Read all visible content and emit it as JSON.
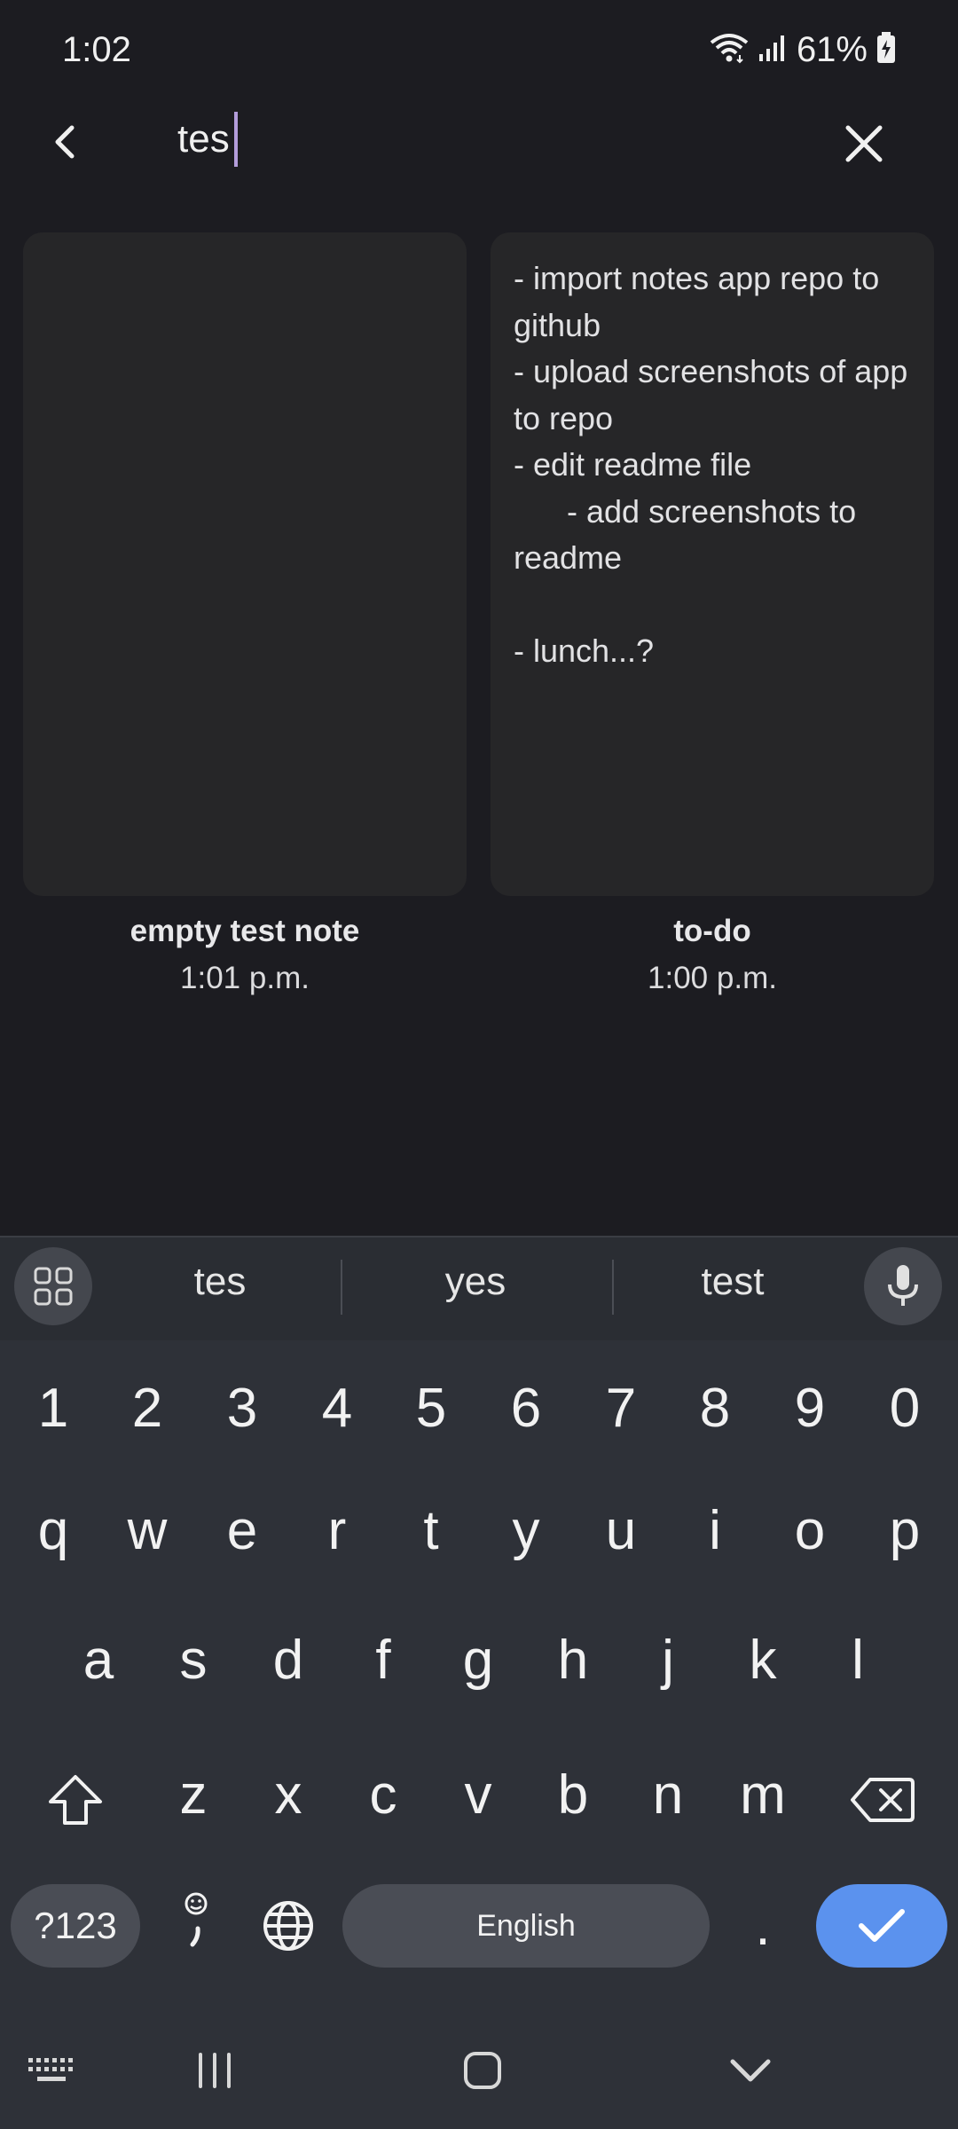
{
  "status_bar": {
    "time": "1:02",
    "battery": "61%",
    "icons": [
      "wifi-icon",
      "signal-icon",
      "battery-charging-icon"
    ]
  },
  "search": {
    "query": "tes",
    "back_icon": "chevron-left-icon",
    "clear_icon": "close-icon"
  },
  "notes": [
    {
      "title": "empty test note",
      "time": "1:01 p.m.",
      "body": ""
    },
    {
      "title": "to-do",
      "time": "1:00 p.m.",
      "body": "- import notes app repo to github\n- upload screenshots of app to repo\n- edit readme file\n      - add screenshots to readme\n\n- lunch...?"
    }
  ],
  "keyboard": {
    "suggestions": [
      "tes",
      "yes",
      "test"
    ],
    "row_numbers": [
      "1",
      "2",
      "3",
      "4",
      "5",
      "6",
      "7",
      "8",
      "9",
      "0"
    ],
    "row_q": [
      "q",
      "w",
      "e",
      "r",
      "t",
      "y",
      "u",
      "i",
      "o",
      "p"
    ],
    "row_a": [
      "a",
      "s",
      "d",
      "f",
      "g",
      "h",
      "j",
      "k",
      "l"
    ],
    "row_z": [
      "z",
      "x",
      "c",
      "v",
      "b",
      "n",
      "m"
    ],
    "symbols_label": "?123",
    "space_label": "English",
    "period_label": ".",
    "accent": "#5b92ee"
  },
  "colors": {
    "background": "#1c1c21",
    "card": "#262628",
    "caret": "#b39ddb"
  }
}
